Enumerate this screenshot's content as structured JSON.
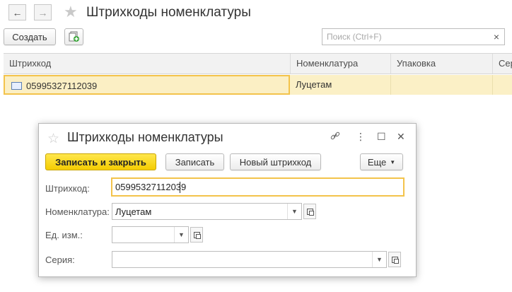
{
  "header": {
    "title": "Штрихкоды номенклатуры",
    "back_icon": "arrow-left-icon",
    "forward_icon": "arrow-right-icon",
    "favorite_icon": "star-icon"
  },
  "toolbar": {
    "create_label": "Создать",
    "copy_icon": "copy-add-icon",
    "search_placeholder": "Поиск (Ctrl+F)",
    "search_clear": "×"
  },
  "table": {
    "columns": [
      "Штрихкод",
      "Номенклатура",
      "Упаковка",
      "Сери"
    ],
    "rows": [
      {
        "barcode": "05995327112039",
        "nomenclature": "Луцетам",
        "package": "",
        "series": ""
      }
    ]
  },
  "dialog": {
    "title": "Штрихкоды номенклатуры",
    "link_icon": "🔗",
    "more_icon": "⋮",
    "maximize_icon": "☐",
    "close_icon": "✕",
    "save_close_label": "Записать и закрыть",
    "save_label": "Записать",
    "new_barcode_label": "Новый штрихкод",
    "more_label": "Еще",
    "fields": {
      "barcode_label": "Штрихкод:",
      "barcode_value": "05995327112039",
      "nomenclature_label": "Номенклатура:",
      "nomenclature_value": "Луцетам",
      "unit_label": "Ед. изм.:",
      "unit_value": "",
      "series_label": "Серия:",
      "series_value": ""
    }
  },
  "colors": {
    "accent_yellow": "#f4cc00",
    "selection_border": "#f3c34b",
    "selection_bg": "#fbf0c6"
  }
}
